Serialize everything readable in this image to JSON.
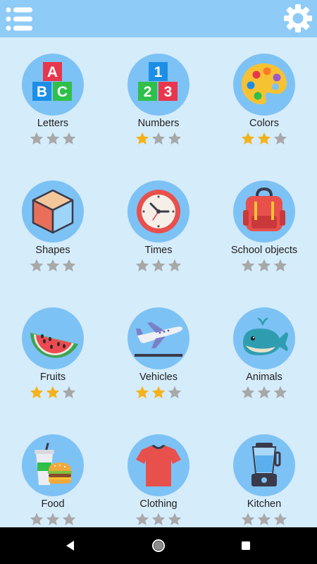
{
  "app": {
    "menu_icon": "list-menu-icon",
    "settings_icon": "gear-icon",
    "colors": {
      "background": "#d5ecfb",
      "topbar": "#8ecbf6",
      "circle": "#7dc2f5",
      "star_filled": "#f6b21b",
      "star_empty": "#a8a8a8"
    }
  },
  "categories": [
    {
      "label": "Letters",
      "icon": "abc-blocks-icon",
      "stars": 0
    },
    {
      "label": "Numbers",
      "icon": "number-blocks-icon",
      "stars": 1
    },
    {
      "label": "Colors",
      "icon": "paint-palette-icon",
      "stars": 2
    },
    {
      "label": "Shapes",
      "icon": "cube-icon",
      "stars": 0
    },
    {
      "label": "Times",
      "icon": "clock-icon",
      "stars": 0
    },
    {
      "label": "School objects",
      "icon": "backpack-icon",
      "stars": 0
    },
    {
      "label": "Fruits",
      "icon": "watermelon-icon",
      "stars": 2
    },
    {
      "label": "Vehicles",
      "icon": "airplane-icon",
      "stars": 2
    },
    {
      "label": "Animals",
      "icon": "whale-icon",
      "stars": 0
    },
    {
      "label": "Food",
      "icon": "burger-drink-icon",
      "stars": 0
    },
    {
      "label": "Clothing",
      "icon": "tshirt-icon",
      "stars": 0
    },
    {
      "label": "Kitchen",
      "icon": "blender-icon",
      "stars": 0
    }
  ],
  "max_stars": 3,
  "navbar": {
    "back_icon": "back-triangle-icon",
    "home_icon": "home-circle-icon",
    "recents_icon": "recents-square-icon"
  }
}
